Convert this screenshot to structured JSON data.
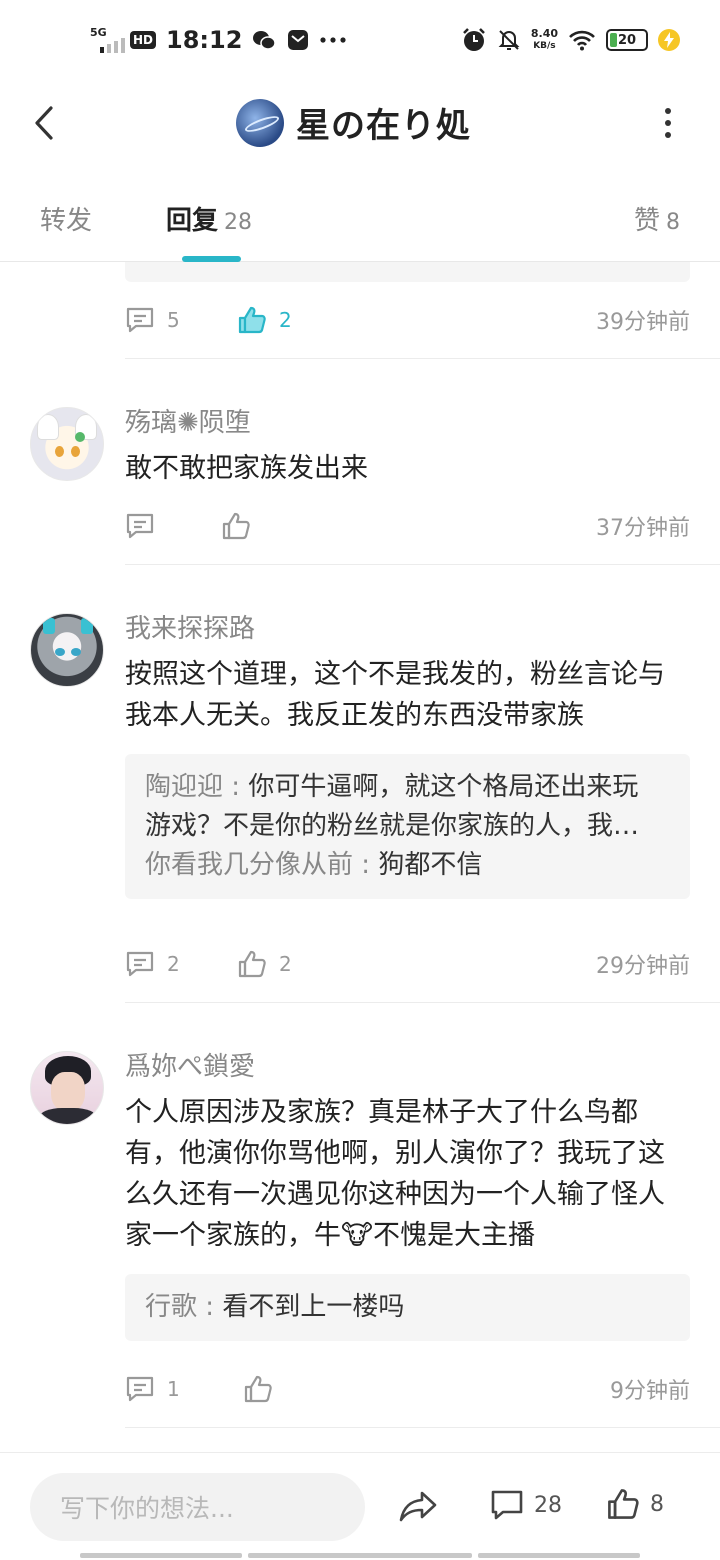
{
  "status_bar": {
    "network": "5G",
    "hd": "HD",
    "time": "18:12",
    "speed_value": "8.40",
    "speed_unit": "KB/s",
    "battery": "20"
  },
  "header": {
    "title": "星の在り処",
    "back_icon": "chevron-left-icon",
    "more_icon": "more-vertical-icon"
  },
  "tabs": {
    "forward_label": "转发",
    "reply_label": "回复",
    "reply_count": "28",
    "like_label": "赞",
    "like_count": "8",
    "active": "reply"
  },
  "colors": {
    "accent": "#29b6c8",
    "quote_bg": "#f5f5f5",
    "muted_text": "#999999"
  },
  "feed": {
    "top_actions": {
      "comment_count": "5",
      "like_count": "2",
      "like_active": true,
      "time": "39分钟前"
    },
    "comments": [
      {
        "user": "殇璃✺陨堕",
        "text": "敢不敢把家族发出来",
        "comment_count": "",
        "like_count": "",
        "time": "37分钟前",
        "replies": []
      },
      {
        "user": "我来探探路",
        "text": "按照这个道理，这个不是我发的，粉丝言论与我本人无关。我反正发的东西没带家族",
        "comment_count": "2",
        "like_count": "2",
        "time": "29分钟前",
        "replies": [
          {
            "name": "陶迎迎",
            "sep": " : ",
            "text": "你可牛逼啊，就这个格局还出来玩"
          },
          {
            "name": "",
            "sep": "",
            "text": "游戏？不是你的粉丝就是你家族的人，我…"
          },
          {
            "name": "你看我几分像从前",
            "sep": " : ",
            "text": "狗都不信"
          }
        ]
      },
      {
        "user": "爲妳ぺ鎖愛",
        "text": "个人原因涉及家族？真是林子大了什么鸟都有，他演你你骂他啊，别人演你了？我玩了这么久还有一次遇见你这种因为一个人输了怪人家一个家族的，牛🐮不愧是大主播",
        "comment_count": "1",
        "like_count": "",
        "time": "9分钟前",
        "replies": [
          {
            "name": "行歌",
            "sep": " : ",
            "text": "看不到上一楼吗"
          }
        ]
      }
    ]
  },
  "bottom_bar": {
    "input_placeholder": "写下你的想法...",
    "share_icon": "share-icon",
    "comment_count": "28",
    "like_count": "8"
  }
}
